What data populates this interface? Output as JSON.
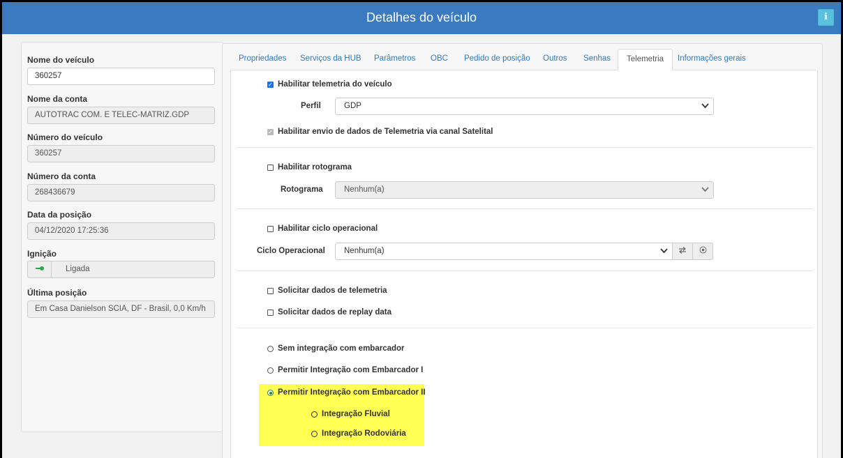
{
  "header": {
    "title": "Detalhes do veículo",
    "info_icon": "i"
  },
  "vehicle": {
    "fields": [
      {
        "label": "Nome do veículo",
        "value": "360257"
      },
      {
        "label": "Nome da conta",
        "value": "AUTOTRAC COM. E TELEC-MATRIZ.GDP"
      },
      {
        "label": "Número do veículo",
        "value": "360257"
      },
      {
        "label": "Número da conta",
        "value": "268436679"
      },
      {
        "label": "Data da posição",
        "value": "04/12/2020 17:25:36"
      },
      {
        "label": "Ignição",
        "value": "Ligada",
        "icon": "key-icon"
      },
      {
        "label": "Última posição",
        "value": "Em  Casa Danielson SCIA, DF - Brasil, 0,0 Km/h"
      }
    ]
  },
  "tabs": [
    "Propriedades",
    "Serviços da HUB",
    "Parâmetros",
    "OBC",
    "Pedido de posição",
    "Outros",
    "Senhas",
    "Telemetria",
    "Informações gerais"
  ],
  "active_tab": "Telemetria",
  "telemetry": {
    "enable_label": "Habilitar telemetria do veículo",
    "enable_checked": true,
    "perfil_label": "Perfil",
    "perfil_value": "GDP",
    "satellite_label": "Habilitar envio de dados de Telemetria via canal Satelital",
    "satellite_checked": true,
    "rotograma_enable_label": "Habilitar rotograma",
    "rotograma_label": "Rotograma",
    "rotograma_value": "Nenhum(a)",
    "ciclo_enable_label": "Habilitar ciclo operacional",
    "ciclo_label": "Ciclo Operacional",
    "ciclo_value": "Nenhum(a)",
    "request_telemetry_label": "Solicitar dados de telemetria",
    "request_replay_label": "Solicitar dados de replay data",
    "radio_none_label": "Sem integração com embarcador",
    "radio_i_label": "Permitir Integração com Embarcador I",
    "radio_ii_label": "Permitir Integração com Embarcador II",
    "sub_fluvial_label": "Integração Fluvial",
    "sub_rodoviaria_label": "Integração Rodoviária",
    "highlight_color": "#ffff54",
    "accent_color": "#3a7abf"
  }
}
